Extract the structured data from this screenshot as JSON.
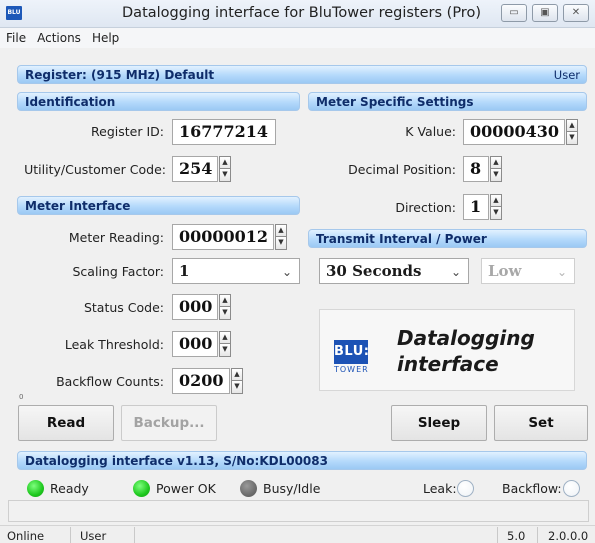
{
  "window": {
    "title": "Datalogging interface for BluTower registers (Pro)",
    "app_icon_text": "BLU",
    "minimize_glyph": "▭",
    "maximize_glyph": "▣",
    "close_glyph": "✕"
  },
  "menu": [
    "File",
    "Actions",
    "Help"
  ],
  "register_band": {
    "title": "Register: (915 MHz) Default",
    "mode": "User"
  },
  "identification": {
    "header": "Identification",
    "register_id_label": "Register ID:",
    "register_id": "16777214",
    "utility_label": "Utility/Customer Code:",
    "utility_code": "254"
  },
  "meter_interface": {
    "header": "Meter Interface",
    "meter_reading_label": "Meter Reading:",
    "meter_reading": "00000012",
    "scaling_label": "Scaling Factor:",
    "scaling_value": "1",
    "status_label": "Status Code:",
    "status_value": "000",
    "leak_label": "Leak Threshold:",
    "leak_value": "000",
    "backflow_label": "Backflow Counts:",
    "backflow_value": "0200",
    "tiny_value": "0"
  },
  "meter_settings": {
    "header": "Meter Specific Settings",
    "k_label": "K Value:",
    "k_value": "00000430",
    "decimal_label": "Decimal Position:",
    "decimal_value": "8",
    "direction_label": "Direction:",
    "direction_value": "1"
  },
  "transmit": {
    "header": "Transmit Interval / Power",
    "interval": "30 Seconds",
    "power": "Low"
  },
  "logo": {
    "mark": "BLU:",
    "sub": "TOWER",
    "line1": "Datalogging",
    "line2": "interface"
  },
  "buttons": {
    "read": "Read",
    "backup": "Backup...",
    "sleep": "Sleep",
    "set": "Set"
  },
  "version_band": "Datalogging interface v1.13, S/No:KDL00083",
  "status": {
    "ready": "Ready",
    "power": "Power OK",
    "busy": "Busy/Idle",
    "leak": "Leak:",
    "backflow": "Backflow:"
  },
  "statusbar": {
    "state": "Online",
    "user": "User",
    "ver1": "5.0",
    "ver2": "2.0.0.0"
  },
  "colors": {
    "band": "#b4d9fb",
    "band_text": "#0f2d6a",
    "led_green": "#1ec81e",
    "led_gray": "#6d6d6d",
    "logo_blue": "#1c52b5"
  }
}
